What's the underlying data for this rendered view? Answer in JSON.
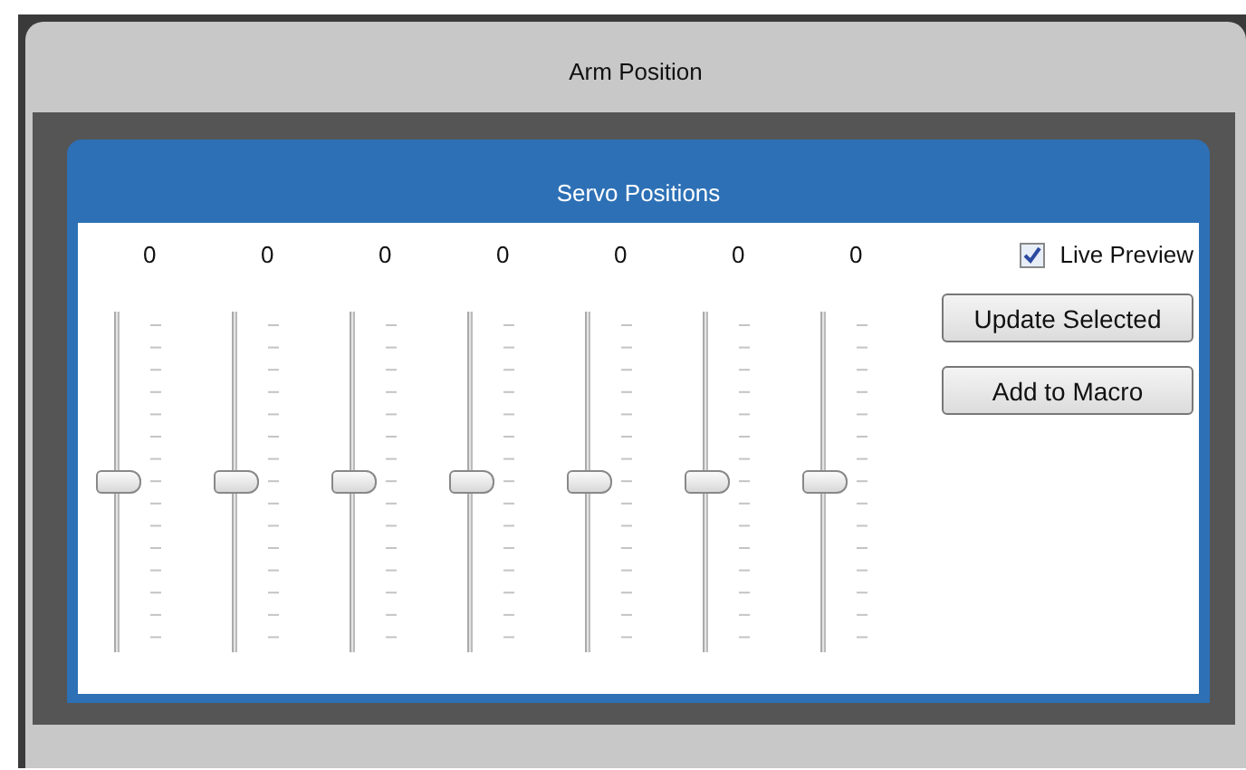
{
  "window": {
    "title": "Arm Position"
  },
  "panel": {
    "title": "Servo Positions"
  },
  "sliders": [
    {
      "reading": "0",
      "level": 0.5
    },
    {
      "reading": "0",
      "level": 0.5
    },
    {
      "reading": "0",
      "level": 0.5
    },
    {
      "reading": "0",
      "level": 0.5
    },
    {
      "reading": "0",
      "level": 0.5
    },
    {
      "reading": "0",
      "level": 0.5
    },
    {
      "reading": "0",
      "level": 0.5
    }
  ],
  "live_preview": {
    "label": "Live Preview",
    "checked": true
  },
  "buttons": [
    "Update Selected",
    "Add to Macro"
  ]
}
